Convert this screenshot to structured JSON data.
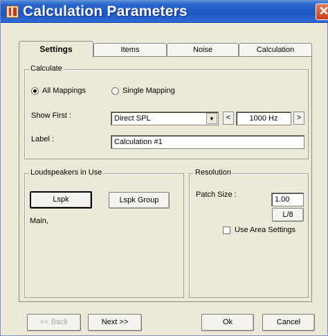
{
  "window": {
    "title": "Calculation Parameters",
    "close_glyph": "✕"
  },
  "tabs": [
    {
      "label": "Settings",
      "active": true
    },
    {
      "label": "Items",
      "active": false
    },
    {
      "label": "Noise",
      "active": false
    },
    {
      "label": "Calculation",
      "active": false
    }
  ],
  "calculate": {
    "title": "Calculate",
    "mode_all": {
      "label": "All Mappings",
      "selected": true
    },
    "mode_single": {
      "label": "Single Mapping",
      "selected": false
    },
    "show_first_label": "Show First :",
    "show_first_value": "Direct SPL",
    "frequency_prev": "<",
    "frequency_value": "1000 Hz",
    "frequency_next": ">",
    "label_label": "Label :",
    "label_value": "Calculation #1"
  },
  "loudspeakers": {
    "title": "Loudspeakers in Use",
    "lspk_button": "Lspk",
    "lspk_group_button": "Lspk Group",
    "in_use_text": "Main,"
  },
  "resolution": {
    "title": "Resolution",
    "patch_size_label": "Patch Size :",
    "patch_size_value": "1.00",
    "l8_button": "L/8",
    "use_area_settings_label": "Use Area Settings",
    "use_area_settings_checked": false
  },
  "footer": {
    "back_label": "<< Back",
    "next_label": "Next >>",
    "ok_label": "Ok",
    "cancel_label": "Cancel"
  },
  "icons": {
    "app": "app-logo-icon",
    "close": "close-icon",
    "dropdown": "chevron-down-icon"
  },
  "colors": {
    "titlebar": "#1f57c3",
    "close": "#c9421c",
    "dialog_bg": "#ece9d8"
  }
}
